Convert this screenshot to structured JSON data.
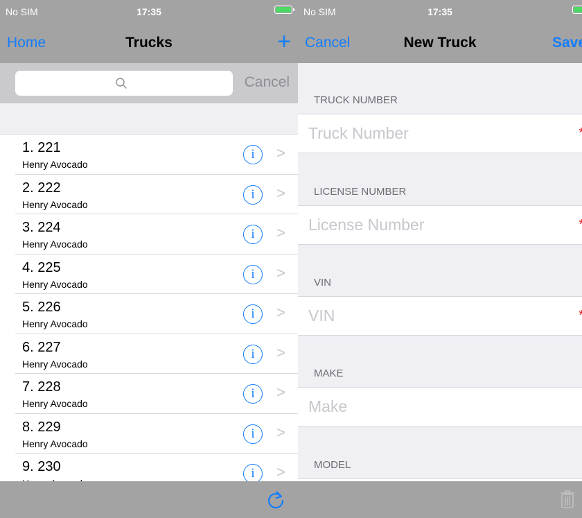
{
  "status": {
    "carrier": "No SIM",
    "time": "17:35"
  },
  "left": {
    "nav": {
      "left_label": "Home",
      "title": "Trucks",
      "add_label": "+"
    },
    "search": {
      "placeholder": "",
      "cancel_label": "Cancel"
    },
    "trucks": [
      {
        "title": "1. 221",
        "driver": "Henry Avocado"
      },
      {
        "title": "2. 222",
        "driver": "Henry Avocado"
      },
      {
        "title": "3. 224",
        "driver": "Henry Avocado"
      },
      {
        "title": "4. 225",
        "driver": "Henry Avocado"
      },
      {
        "title": "5. 226",
        "driver": "Henry Avocado"
      },
      {
        "title": "6. 227",
        "driver": "Henry Avocado"
      },
      {
        "title": "7. 228",
        "driver": "Henry Avocado"
      },
      {
        "title": "8. 229",
        "driver": "Henry Avocado"
      },
      {
        "title": "9. 230",
        "driver": "Henry Avocado"
      }
    ],
    "info_glyph": "i",
    "chevron_glyph": ">",
    "toolbar_icon": "refresh-icon"
  },
  "right": {
    "nav": {
      "cancel_label": "Cancel",
      "title": "New Truck",
      "save_label": "Save"
    },
    "fields": [
      {
        "header": "TRUCK NUMBER",
        "placeholder": "Truck Number",
        "required_mark": "*"
      },
      {
        "header": "LICENSE NUMBER",
        "placeholder": "License Number",
        "required_mark": "*"
      },
      {
        "header": "VIN",
        "placeholder": "VIN",
        "required_mark": "*"
      },
      {
        "header": "MAKE",
        "placeholder": "Make",
        "required_mark": ""
      },
      {
        "header": "MODEL",
        "placeholder": "",
        "required_mark": ""
      }
    ],
    "toolbar_icon": "trash-icon"
  },
  "colors": {
    "accent": "#147efb",
    "bar": "#a3a3a3",
    "required": "#e02020"
  }
}
